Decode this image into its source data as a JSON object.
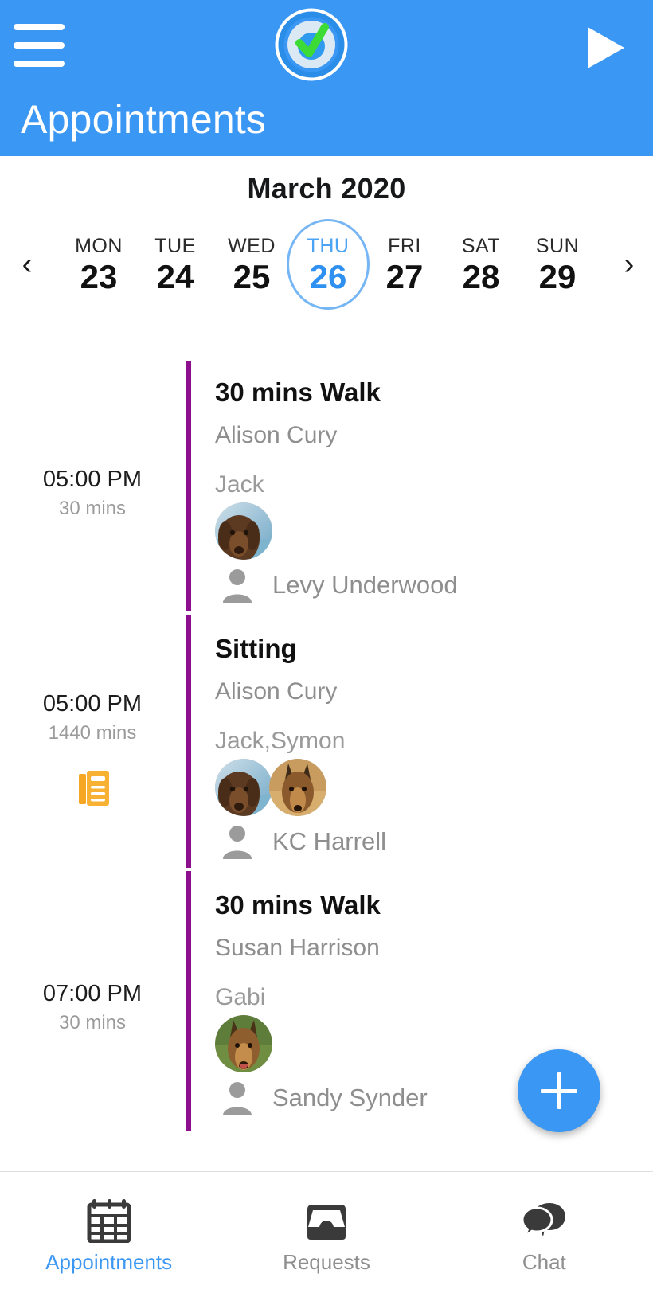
{
  "appbar": {
    "menu_icon": "hamburger-menu-icon",
    "logo_icon": "target-check-logo",
    "play_icon": "play-triangle-icon",
    "title": "Appointments"
  },
  "calendar": {
    "month": "March 2020",
    "prev_label": "‹",
    "next_label": "›",
    "days": [
      {
        "dow": "MON",
        "num": "23",
        "selected": false
      },
      {
        "dow": "TUE",
        "num": "24",
        "selected": false
      },
      {
        "dow": "WED",
        "num": "25",
        "selected": false
      },
      {
        "dow": "THU",
        "num": "26",
        "selected": true
      },
      {
        "dow": "FRI",
        "num": "27",
        "selected": false
      },
      {
        "dow": "SAT",
        "num": "28",
        "selected": false
      },
      {
        "dow": "SUN",
        "num": "29",
        "selected": false
      }
    ],
    "selected_color": "#2e90f0"
  },
  "appointments": [
    {
      "time": "05:00 PM",
      "duration": "30 mins",
      "title": "30 mins Walk",
      "owner": "Alison Cury",
      "pets": "Jack",
      "pet_avatars": [
        "dog-brown-water-avatar"
      ],
      "walker": "Levy Underwood",
      "walker_icon": "person-silhouette-icon",
      "has_note": false,
      "bar_color": "#8e0f8e"
    },
    {
      "time": "05:00 PM",
      "duration": "1440 mins",
      "title": "Sitting",
      "owner": "Alison Cury",
      "pets": "Jack,Symon",
      "pet_avatars": [
        "dog-brown-water-avatar",
        "dog-shepherd-avatar"
      ],
      "walker": "KC Harrell",
      "walker_icon": "person-silhouette-icon",
      "has_note": true,
      "note_icon": "notes-document-icon",
      "note_color": "#f5a623",
      "bar_color": "#8e0f8e"
    },
    {
      "time": "07:00 PM",
      "duration": "30 mins",
      "title": "30 mins Walk",
      "owner": "Susan  Harrison",
      "pets": "Gabi",
      "pet_avatars": [
        "dog-shepherd-grass-avatar"
      ],
      "walker": "Sandy Synder",
      "walker_icon": "person-silhouette-icon",
      "has_note": false,
      "bar_color": "#8e0f8e"
    }
  ],
  "fab": {
    "icon": "plus-icon",
    "color": "#3b97f4"
  },
  "bottom_nav": {
    "items": [
      {
        "label": "Appointments",
        "icon": "calendar-icon",
        "active": true
      },
      {
        "label": "Requests",
        "icon": "inbox-tray-icon",
        "active": false
      },
      {
        "label": "Chat",
        "icon": "chat-bubbles-icon",
        "active": false
      }
    ],
    "active_color": "#3b97f4"
  },
  "theme": {
    "header_blue": "#3b97f4",
    "timeline_purple": "#8e0f8e",
    "muted_text": "#8e8e8e"
  }
}
